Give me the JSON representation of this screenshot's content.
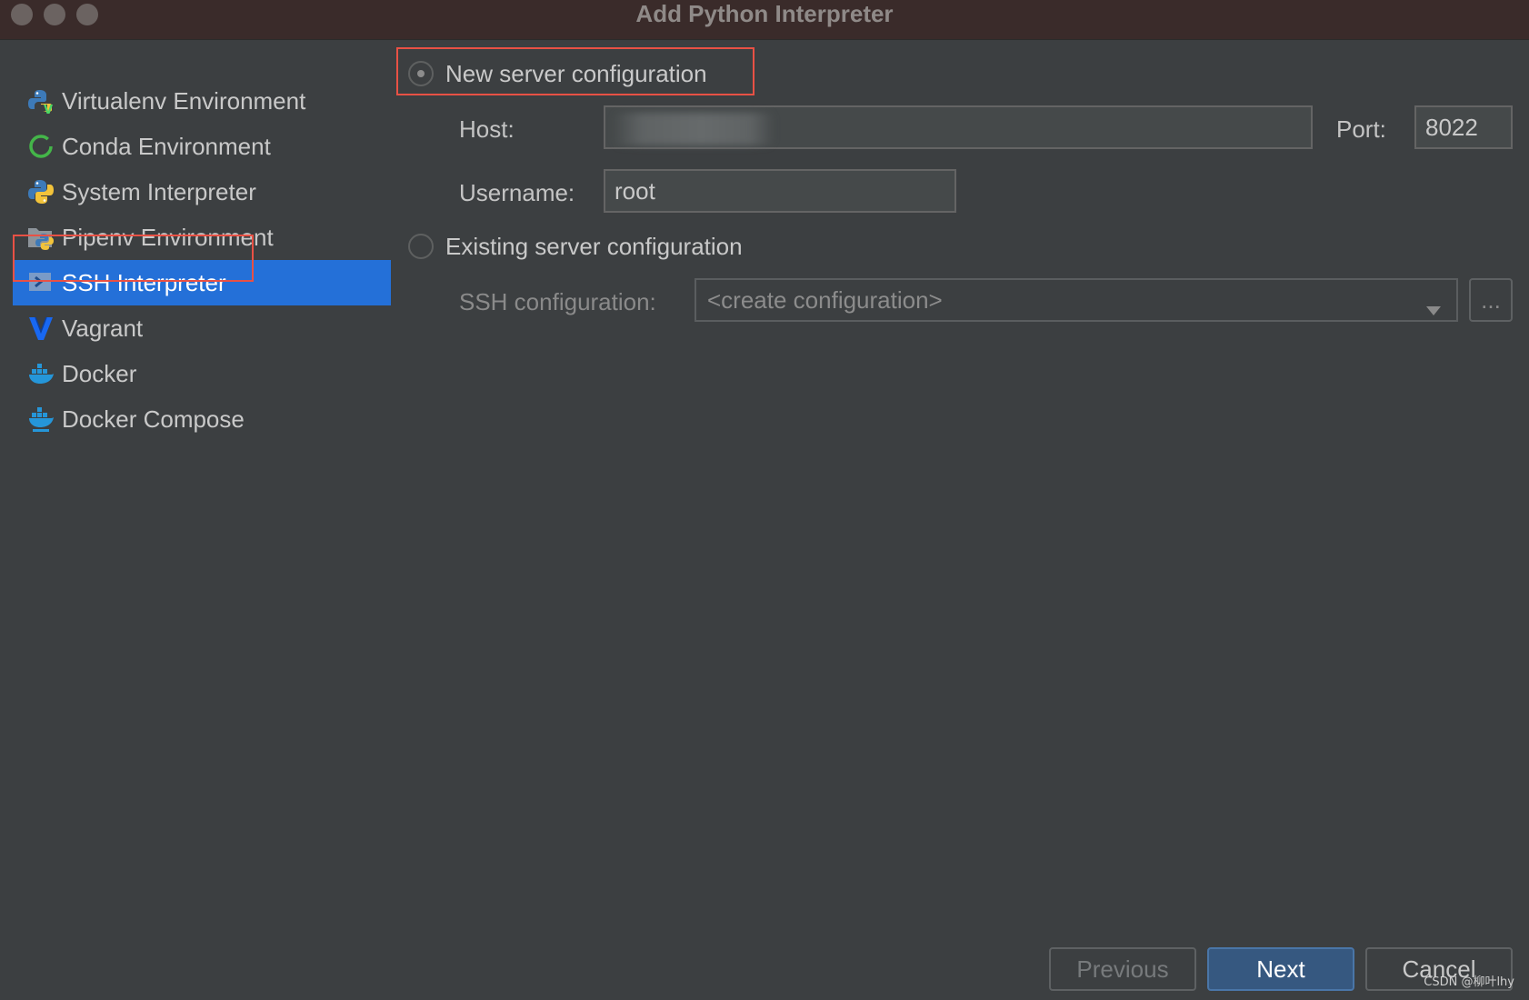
{
  "window": {
    "title": "Add Python Interpreter"
  },
  "sidebar": {
    "items": [
      {
        "label": "Virtualenv Environment",
        "icon": "python-virtualenv-icon"
      },
      {
        "label": "Conda Environment",
        "icon": "conda-icon"
      },
      {
        "label": "System Interpreter",
        "icon": "python-icon"
      },
      {
        "label": "Pipenv Environment",
        "icon": "pipenv-icon"
      },
      {
        "label": "SSH Interpreter",
        "icon": "ssh-terminal-icon",
        "selected": true
      },
      {
        "label": "Vagrant",
        "icon": "vagrant-icon"
      },
      {
        "label": "Docker",
        "icon": "docker-icon"
      },
      {
        "label": "Docker Compose",
        "icon": "docker-compose-icon"
      }
    ]
  },
  "form": {
    "new_server": {
      "label": "New server configuration",
      "selected": true,
      "host_label": "Host:",
      "host_value": "",
      "port_label": "Port:",
      "port_value": "8022",
      "username_label": "Username:",
      "username_value": "root"
    },
    "existing_server": {
      "label": "Existing server configuration",
      "selected": false,
      "ssh_config_label": "SSH configuration:",
      "ssh_config_value": "<create configuration>",
      "browse_label": "..."
    }
  },
  "buttons": {
    "previous": "Previous",
    "next": "Next",
    "cancel": "Cancel"
  },
  "watermark": "CSDN @柳叶lhy",
  "colors": {
    "background": "#3c3f41",
    "selection": "#2470d8",
    "highlight_border": "#e85145",
    "primary_button": "#365880"
  }
}
